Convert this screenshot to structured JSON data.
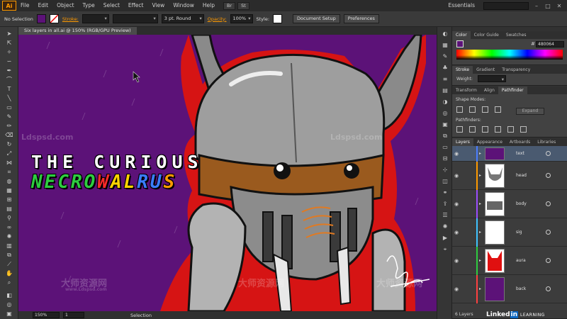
{
  "menubar": {
    "logo": "Ai",
    "items": [
      "File",
      "Edit",
      "Object",
      "Type",
      "Select",
      "Effect",
      "View",
      "Window",
      "Help"
    ],
    "workspace": "Essentials",
    "buttons": [
      "Br",
      "St"
    ]
  },
  "controlbar": {
    "selection": "No Selection",
    "stroke_label": "Stroke:",
    "brush_value": "3 pt. Round",
    "opacity_label": "Opacity:",
    "opacity_value": "100%",
    "style_label": "Style:",
    "doc_setup": "Document Setup",
    "preferences": "Preferences",
    "fill_color": "#5c1278"
  },
  "document": {
    "tab_title": "Six layers in all.ai @ 150% (RGB/GPU Preview)"
  },
  "artwork": {
    "title_line1": "THE CURIOUS",
    "title_line2_letters": [
      {
        "ch": "N",
        "color": "#2ecc40"
      },
      {
        "ch": "E",
        "color": "#2ecc40"
      },
      {
        "ch": "C",
        "color": "#2ecc40"
      },
      {
        "ch": "R",
        "color": "#2ecc40"
      },
      {
        "ch": "O",
        "color": "#2ecc40"
      },
      {
        "ch": "W",
        "color": "#ff2a2a"
      },
      {
        "ch": "A",
        "color": "#ffd400"
      },
      {
        "ch": "L",
        "color": "#ffd400"
      },
      {
        "ch": "R",
        "color": "#3a7dff"
      },
      {
        "ch": "U",
        "color": "#3a7dff"
      },
      {
        "ch": "S",
        "color": "#ff9a00"
      }
    ],
    "watermark_top": "Ldspsd.com",
    "watermark_bottom": "大师资源网",
    "watermark_sub": "www.Ldspsd.com",
    "background_color": "#5c1278"
  },
  "statusbar": {
    "zoom": "150%",
    "artboard": "1",
    "tool_status": "Selection"
  },
  "color_panel": {
    "tabs": [
      "Color",
      "Color Guide",
      "Swatches"
    ],
    "hex": "480064"
  },
  "stroke_panel": {
    "tabs": [
      "Stroke",
      "Gradient",
      "Transparency"
    ],
    "weight_label": "Weight:"
  },
  "pathfinder_panel": {
    "tabs": [
      "Transform",
      "Align",
      "Pathfinder"
    ],
    "shape_modes": "Shape Modes:",
    "pathfinders": "Pathfinders:",
    "expand": "Expand"
  },
  "layers_panel": {
    "tabs": [
      "Layers",
      "Appearance",
      "Artboards",
      "Libraries"
    ],
    "layers": [
      {
        "name": "text",
        "color": "#4a7dff"
      },
      {
        "name": "head",
        "color": "#ff9a00"
      },
      {
        "name": "body",
        "color": "#9b4dff"
      },
      {
        "name": "sig",
        "color": "#3fc3ff"
      },
      {
        "name": "aura",
        "color": "#2ecc40"
      },
      {
        "name": "back",
        "color": "#ff4040"
      }
    ],
    "count": "6 Layers"
  },
  "branding": {
    "linked": "Linked",
    "in": "in",
    "learning": "LEARNING"
  }
}
